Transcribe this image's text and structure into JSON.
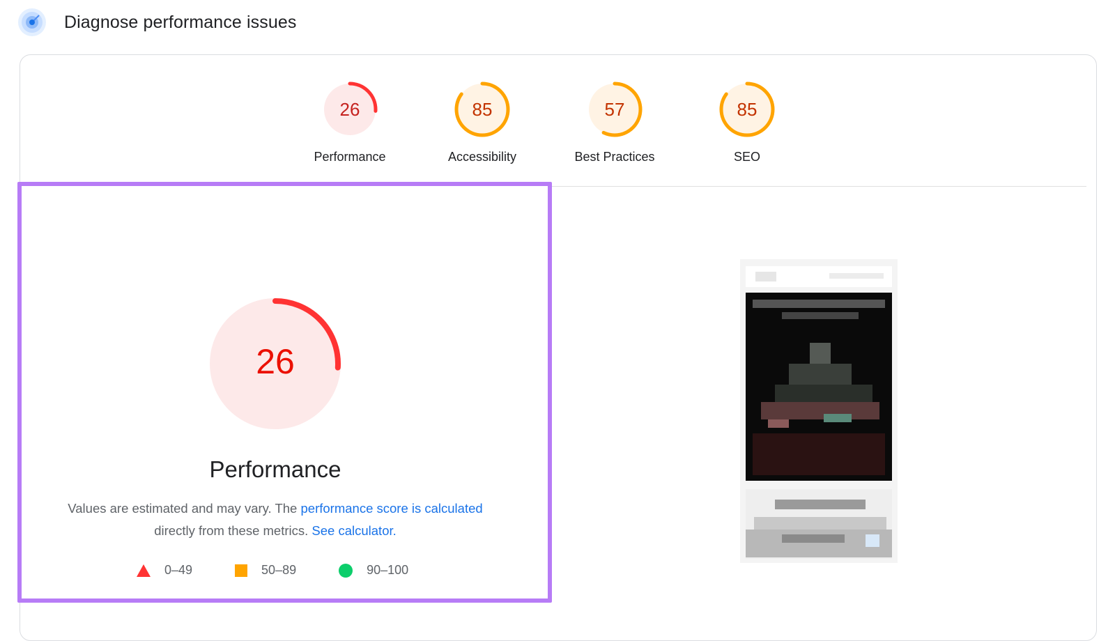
{
  "header": {
    "title": "Diagnose performance issues",
    "icon": "lighthouse-icon"
  },
  "scores": [
    {
      "label": "Performance",
      "value": "26",
      "score": 26,
      "color": "#ff3333",
      "bg": "#fde9e9",
      "text_color": "#c5221f"
    },
    {
      "label": "Accessibility",
      "value": "85",
      "score": 85,
      "color": "#ffa400",
      "bg": "#fff3e4",
      "text_color": "#c33300"
    },
    {
      "label": "Best Practices",
      "value": "57",
      "score": 57,
      "color": "#ffa400",
      "bg": "#fff3e4",
      "text_color": "#c33300"
    },
    {
      "label": "SEO",
      "value": "85",
      "score": 85,
      "color": "#ffa400",
      "bg": "#fff3e4",
      "text_color": "#c33300"
    }
  ],
  "detail": {
    "score": "26",
    "score_value": 26,
    "title": "Performance",
    "desc_prefix": "Values are estimated and may vary. The ",
    "desc_link1": "performance score is calculated",
    "desc_middle": " directly from these metrics. ",
    "desc_link2": "See calculator.",
    "accent": "#ff3333",
    "score_text_color": "#eb0f00"
  },
  "legend": [
    {
      "shape": "triangle",
      "range": "0–49",
      "color": "#ff3333"
    },
    {
      "shape": "square",
      "range": "50–89",
      "color": "#ffa400"
    },
    {
      "shape": "circle",
      "range": "90–100",
      "color": "#0cce6b"
    }
  ],
  "colors": {
    "highlight_border": "#b77cf6",
    "link": "#1a73e8"
  }
}
